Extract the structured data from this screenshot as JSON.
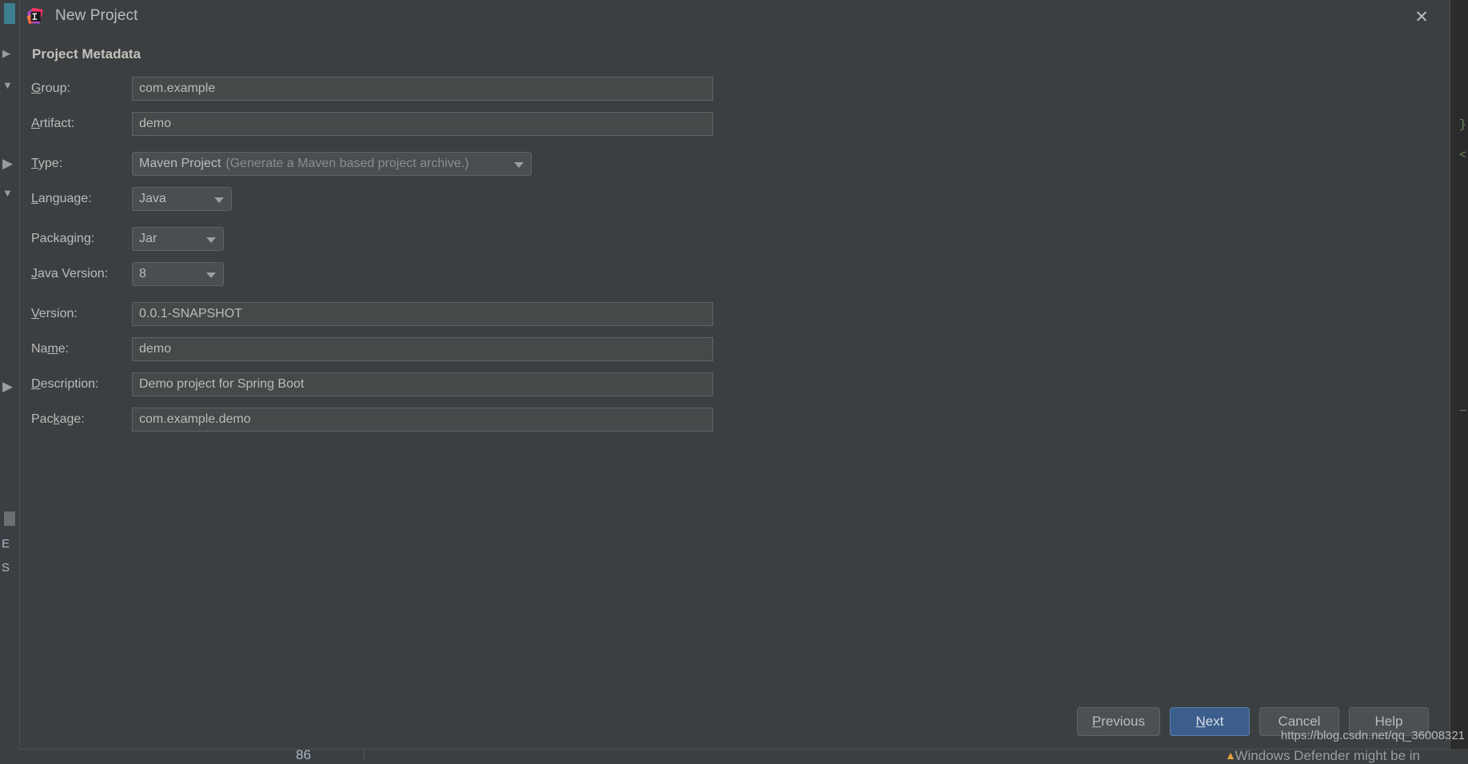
{
  "window": {
    "title": "New Project",
    "logo_icon": "intellij-idea-logo",
    "close_icon": "close-icon"
  },
  "form": {
    "section_title": "Project Metadata",
    "fields": [
      {
        "label": "Group:",
        "mnemonic": "G",
        "mnemonic_index": 0,
        "value": "com.example",
        "kind": "text"
      },
      {
        "label": "Artifact:",
        "mnemonic": "A",
        "mnemonic_index": 0,
        "value": "demo",
        "kind": "text"
      },
      {
        "label": "Type:",
        "mnemonic": "T",
        "mnemonic_index": 0,
        "value": "Maven Project",
        "hint": "(Generate a Maven based project archive.)",
        "kind": "combo"
      },
      {
        "label": "Language:",
        "mnemonic": "L",
        "mnemonic_index": 0,
        "value": "Java",
        "kind": "combo"
      },
      {
        "label": "Packaging:",
        "mnemonic": "g",
        "mnemonic_index": 6,
        "value": "Jar",
        "kind": "combo"
      },
      {
        "label": "Java Version:",
        "mnemonic": "J",
        "mnemonic_index": 0,
        "value": "8",
        "kind": "combo"
      },
      {
        "label": "Version:",
        "mnemonic": "V",
        "mnemonic_index": 0,
        "value": "0.0.1-SNAPSHOT",
        "kind": "text"
      },
      {
        "label": "Name:",
        "mnemonic": "m",
        "mnemonic_index": 2,
        "value": "demo",
        "kind": "text"
      },
      {
        "label": "Description:",
        "mnemonic": "D",
        "mnemonic_index": 0,
        "value": "Demo project for Spring Boot",
        "kind": "text"
      },
      {
        "label": "Package:",
        "mnemonic": "k",
        "mnemonic_index": 4,
        "value": "com.example.demo",
        "kind": "text"
      }
    ],
    "group_label": "Group:",
    "group_value": "com.example",
    "artifact_label": "Artifact:",
    "artifact_value": "demo",
    "type_label": "Type:",
    "type_value": "Maven Project",
    "type_hint": "(Generate a Maven based project archive.)",
    "language_label": "Language:",
    "language_value": "Java",
    "packaging_label": "Packaging:",
    "packaging_value": "Jar",
    "java_version_label": "Java Version:",
    "java_version_value": "8",
    "version_label": "Version:",
    "version_value": "0.0.1-SNAPSHOT",
    "name_label": "Name:",
    "name_value": "demo",
    "description_label": "Description:",
    "description_value": "Demo project for Spring Boot",
    "package_label": "Package:",
    "package_value": "com.example.demo"
  },
  "buttons": {
    "previous": "Previous",
    "next": "Next",
    "cancel": "Cancel",
    "help": "Help"
  },
  "background": {
    "status_number": "86",
    "notification": "Windows Defender might be in",
    "side_letter_1": "E",
    "side_letter_2": "S",
    "code_fragment_1": "}",
    "code_fragment_2": "<"
  },
  "watermark": "https://blog.csdn.net/qq_36008321",
  "colors": {
    "dialog_bg": "#3c3f41",
    "field_bg": "#45494a",
    "border": "#5e6366",
    "text": "#bbbbbb",
    "hint_text": "#8a8d8f",
    "primary_button": "#3b5e8c",
    "code_green": "#6a8759"
  }
}
